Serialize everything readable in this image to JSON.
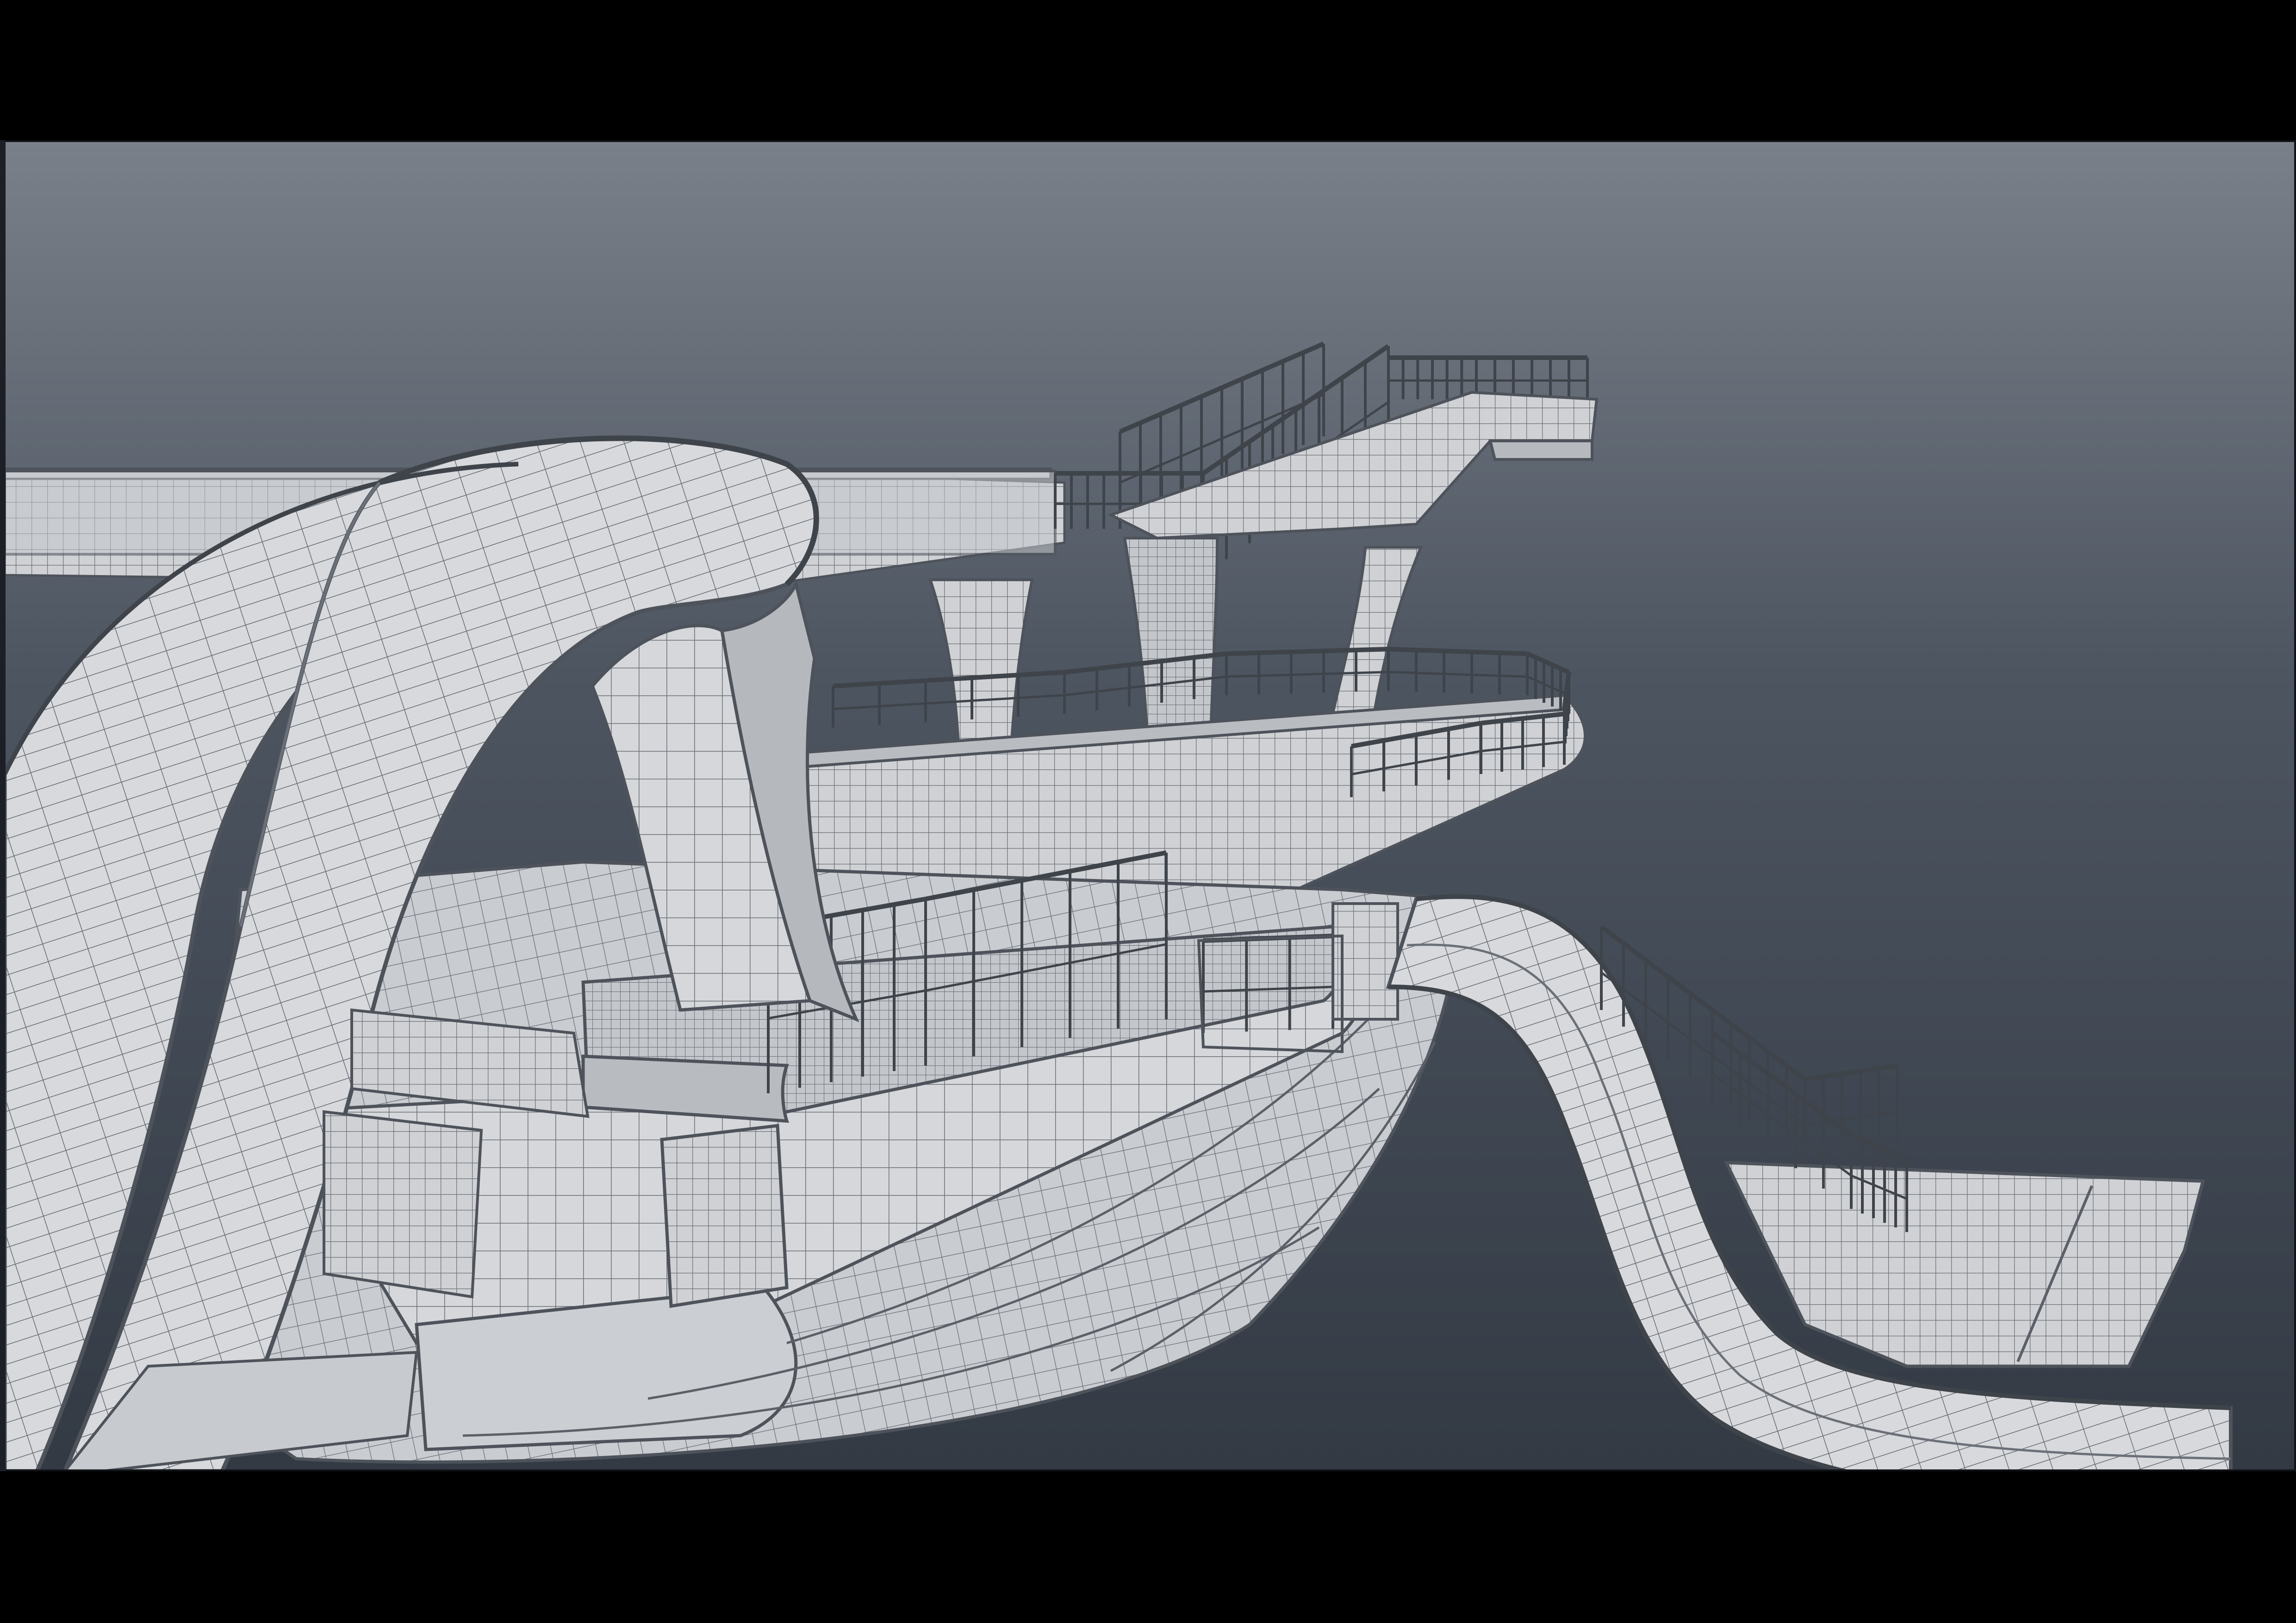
{
  "viewport": {
    "background_top": "#7a8089",
    "background_mid": "#4d5561",
    "background_bottom": "#333a44",
    "mesh_fill": "#d5d7da",
    "mesh_shade": "#a9adb2",
    "mesh_dark": "#8a8f96",
    "wire_color": "#5b6068"
  },
  "scene": {
    "subject": "water-park-slide-tower-wireframe-model"
  }
}
